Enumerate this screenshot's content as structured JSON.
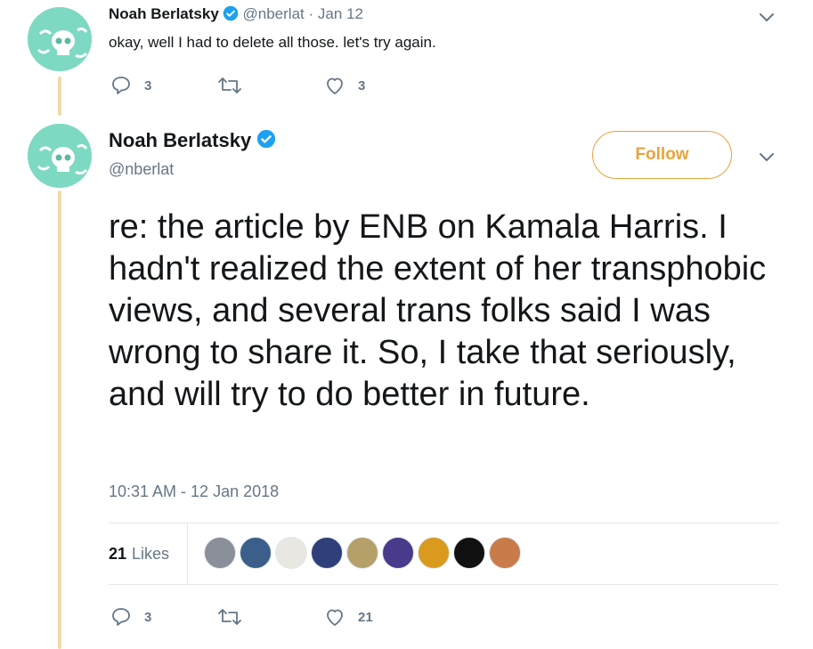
{
  "tweet1": {
    "name": "Noah Berlatsky",
    "handle": "@nberlat",
    "separator": "·",
    "date": "Jan 12",
    "text": "okay, well I had to delete all those. let's try again.",
    "replies": "3",
    "retweets": "",
    "likes": "3"
  },
  "tweet2": {
    "name": "Noah Berlatsky",
    "handle": "@nberlat",
    "follow_label": "Follow",
    "text": "re: the article by ENB on Kamala Harris. I hadn't realized the extent of her transphobic views, and several trans folks said I was wrong to share it. So, I take that seriously, and will try to do better in future.",
    "timestamp": "10:31 AM - 12 Jan 2018",
    "like_count": "21",
    "like_label": "Likes",
    "replies": "3",
    "retweets": "",
    "likes": "21"
  },
  "likers": [
    {
      "name": "liker-1",
      "color": "#8a8f9a"
    },
    {
      "name": "liker-2",
      "color": "#3b5f8a"
    },
    {
      "name": "liker-3",
      "color": "#e9e7e2"
    },
    {
      "name": "liker-4",
      "color": "#2f3f7a"
    },
    {
      "name": "liker-5",
      "color": "#b5a06a"
    },
    {
      "name": "liker-6",
      "color": "#4a3a8c"
    },
    {
      "name": "liker-7",
      "color": "#d99a1e"
    },
    {
      "name": "liker-8",
      "color": "#111111"
    },
    {
      "name": "liker-9",
      "color": "#c97b4a"
    }
  ],
  "colors": {
    "accent": "#e8a33d",
    "verified": "#1da1f2",
    "muted": "#657786",
    "thread_line": "#f3d9a8",
    "avatar_bg": "#7ed9c2"
  },
  "icons": {
    "verified": "verified-badge-icon",
    "chevron": "chevron-down-icon",
    "reply": "reply-icon",
    "retweet": "retweet-icon",
    "like": "heart-icon"
  }
}
